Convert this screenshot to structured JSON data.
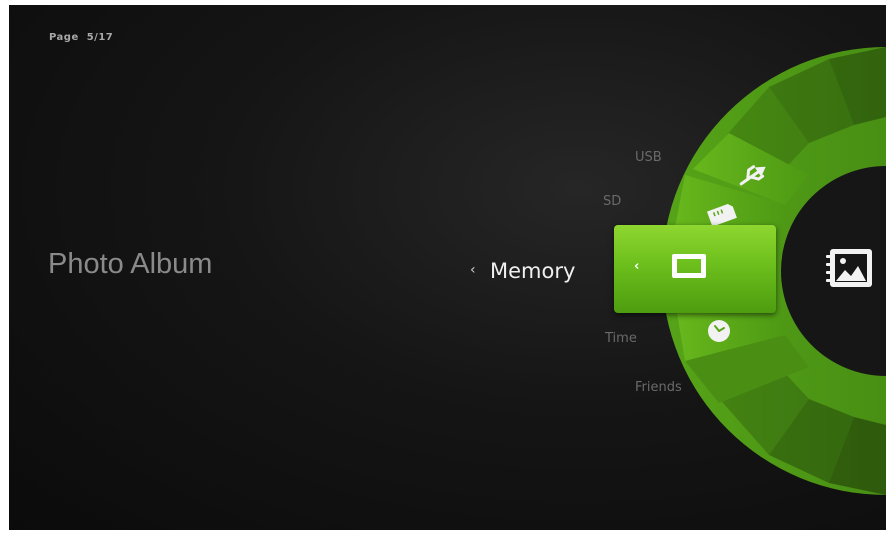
{
  "page_indicator": "Page  5/17",
  "app_title": "Photo Album",
  "selected_item": {
    "label": "Memory",
    "back_chevron": "‹",
    "icon": "picture-frame-icon"
  },
  "menu_items": [
    {
      "label": "USB",
      "icon": "usb-icon"
    },
    {
      "label": "SD",
      "icon": "sd-card-icon"
    },
    {
      "label": "Time",
      "icon": "clock-icon"
    },
    {
      "label": "Friends",
      "icon": ""
    }
  ],
  "wheel_center_icon": "photo-album-icon",
  "colors": {
    "background": "#101010",
    "accent_green": "#6cbf1c",
    "wheel_dark_green": "#3f7c12"
  }
}
